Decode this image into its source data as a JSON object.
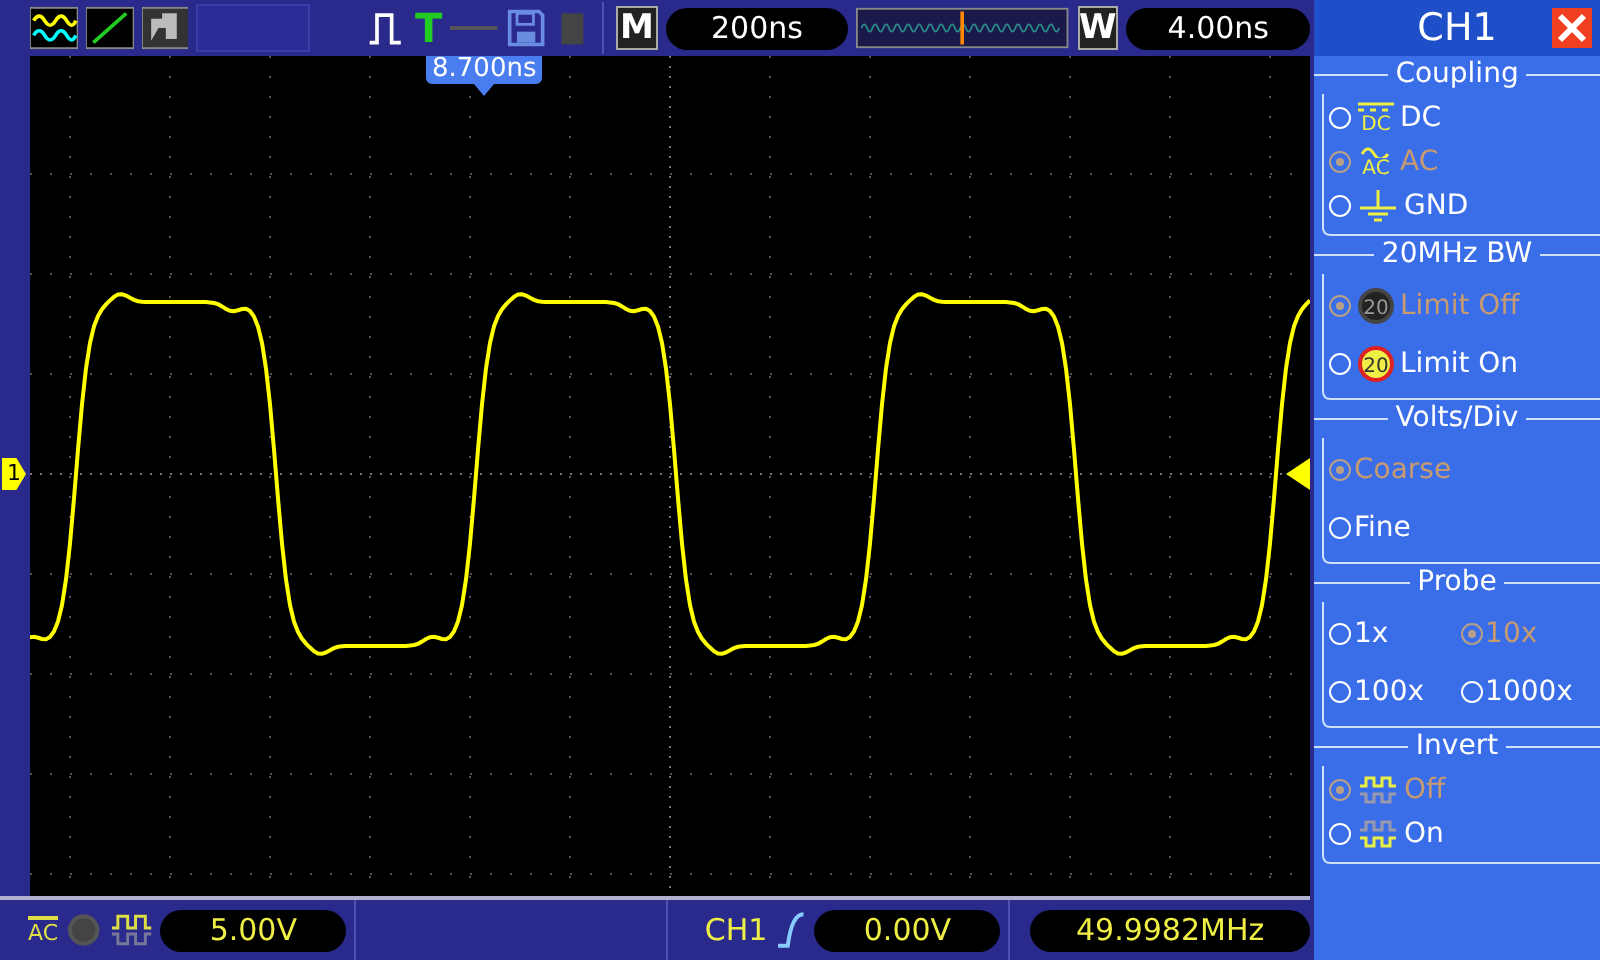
{
  "top_bar": {
    "trigger_mode_label": "T",
    "timebase_label": "M",
    "timebase": "200ns",
    "window_label": "W",
    "window_offset": "4.00ns"
  },
  "screen": {
    "trigger_position": "8.700ns",
    "channel_marker": "1"
  },
  "panel": {
    "title": "CH1",
    "sections": [
      {
        "title": "Coupling",
        "options": [
          {
            "label": "DC",
            "badge": "DC",
            "kind": "dc",
            "selected": false
          },
          {
            "label": "AC",
            "badge": "AC",
            "kind": "ac",
            "selected": true
          },
          {
            "label": "GND",
            "kind": "ground",
            "selected": false
          }
        ]
      },
      {
        "title": "20MHz BW",
        "options": [
          {
            "label": "Limit Off",
            "badge": "20",
            "kind": "bw-off",
            "selected": true
          },
          {
            "label": "Limit On",
            "badge": "20",
            "kind": "bw-on",
            "selected": false
          }
        ]
      },
      {
        "title": "Volts/Div",
        "options": [
          {
            "label": "Coarse",
            "kind": "plain",
            "selected": true
          },
          {
            "label": "Fine",
            "kind": "plain",
            "selected": false
          }
        ]
      },
      {
        "title": "Probe",
        "options": [
          {
            "label": "1x",
            "kind": "plain",
            "selected": false
          },
          {
            "label": "10x",
            "kind": "plain",
            "selected": true
          },
          {
            "label": "100x",
            "kind": "plain",
            "selected": false
          },
          {
            "label": "1000x",
            "kind": "plain",
            "selected": false
          }
        ]
      },
      {
        "title": "Invert",
        "options": [
          {
            "label": "Off",
            "kind": "invert-off",
            "selected": true
          },
          {
            "label": "On",
            "kind": "invert-on",
            "selected": false
          }
        ]
      }
    ]
  },
  "bottom_bar": {
    "coupling_badge": "AC",
    "volts_div": "5.00V",
    "trigger_source": "CH1",
    "trigger_level": "0.00V",
    "frequency": "49.9982MHz"
  }
}
